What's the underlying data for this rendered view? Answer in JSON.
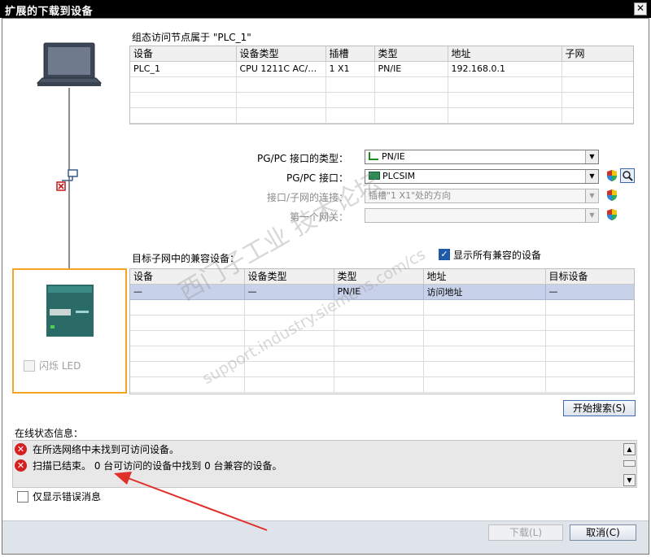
{
  "window": {
    "title": "扩展的下载到设备",
    "close_glyph": "✕"
  },
  "config_node": {
    "caption": "组态访问节点属于 \"PLC_1\"",
    "columns": [
      "设备",
      "设备类型",
      "插槽",
      "类型",
      "地址",
      "子网"
    ],
    "rows": [
      [
        "PLC_1",
        "CPU 1211C AC/D...",
        "1 X1",
        "PN/IE",
        "192.168.0.1",
        ""
      ]
    ]
  },
  "interface": {
    "type_label": "PG/PC 接口的类型：",
    "type_value": "PN/IE",
    "iface_label": "PG/PC 接口：",
    "iface_value": "PLCSIM",
    "conn_label": "接口/子网的连接：",
    "conn_value": "插槽\"1 X1\"处的方向",
    "gateway_label": "第一个网关：",
    "gateway_value": ""
  },
  "compatible": {
    "caption": "目标子网中的兼容设备：",
    "show_all_label": "显示所有兼容的设备",
    "show_all_checked": true,
    "columns": [
      "设备",
      "设备类型",
      "类型",
      "地址",
      "目标设备"
    ],
    "rows": [
      [
        "—",
        "—",
        "PN/IE",
        "访问地址",
        "—"
      ]
    ]
  },
  "device_panel": {
    "flash_led_label": "闪烁 LED"
  },
  "search_button": "开始搜索(S)",
  "status": {
    "caption": "在线状态信息：",
    "messages": [
      {
        "level": "error",
        "text": "在所选网络中未找到可访问设备。"
      },
      {
        "level": "error",
        "text": "扫描已结束。 0 台可访问的设备中找到 0 台兼容的设备。"
      }
    ],
    "errors_only_label": "仅显示错误消息"
  },
  "footer": {
    "download_label": "下载(L)",
    "cancel_label": "取消(C)"
  },
  "watermark": {
    "line1": "西门子工业 技术论坛",
    "line2": "support.industry.siemens.com/cs"
  },
  "colors": {
    "highlight_box": "#f4a422",
    "selected_row": "#c7d1ea",
    "arrow": "#e0302a",
    "error": "#d62020"
  }
}
